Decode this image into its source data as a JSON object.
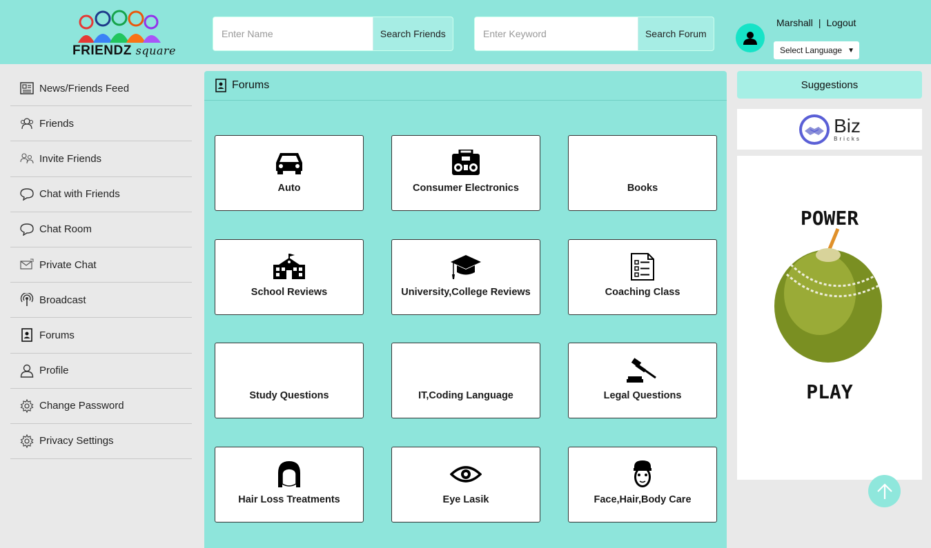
{
  "header": {
    "logo": {
      "brand": "FRIENDZ",
      "suffix": "square"
    },
    "search_friends": {
      "placeholder": "Enter Name",
      "button": "Search Friends"
    },
    "search_forum": {
      "placeholder": "Enter Keyword",
      "button": "Search Forum"
    },
    "user": {
      "name": "Marshall",
      "separator": "|",
      "logout": "Logout"
    },
    "language": {
      "selected": "Select Language"
    }
  },
  "sidebar": {
    "items": [
      {
        "label": "News/Friends Feed",
        "icon": "newspaper-icon"
      },
      {
        "label": "Friends",
        "icon": "friends-icon"
      },
      {
        "label": "Invite Friends",
        "icon": "invite-friends-icon"
      },
      {
        "label": "Chat with Friends",
        "icon": "chat-bubble-icon"
      },
      {
        "label": "Chat Room",
        "icon": "chat-bubble-icon"
      },
      {
        "label": "Private Chat",
        "icon": "envelope-icon"
      },
      {
        "label": "Broadcast",
        "icon": "broadcast-icon"
      },
      {
        "label": "Forums",
        "icon": "forum-document-icon"
      },
      {
        "label": "Profile",
        "icon": "user-icon"
      },
      {
        "label": "Change Password",
        "icon": "gear-icon"
      },
      {
        "label": "Privacy Settings",
        "icon": "gear-icon"
      }
    ]
  },
  "main": {
    "title": "Forums",
    "categories": [
      {
        "label": "Auto",
        "icon": "car-icon"
      },
      {
        "label": "Consumer Electronics",
        "icon": "boombox-icon"
      },
      {
        "label": "Books",
        "icon": ""
      },
      {
        "label": "School Reviews",
        "icon": "school-building-icon"
      },
      {
        "label": "University,College Reviews",
        "icon": "graduation-cap-icon"
      },
      {
        "label": "Coaching Class",
        "icon": "checklist-icon"
      },
      {
        "label": "Study Questions",
        "icon": ""
      },
      {
        "label": "IT,Coding Language",
        "icon": ""
      },
      {
        "label": "Legal Questions",
        "icon": "gavel-icon"
      },
      {
        "label": "Hair Loss Treatments",
        "icon": "hair-icon"
      },
      {
        "label": "Eye Lasik",
        "icon": "eye-icon"
      },
      {
        "label": "Face,Hair,Body Care",
        "icon": "face-mask-icon"
      }
    ]
  },
  "right": {
    "suggestions_title": "Suggestions",
    "sponsor": {
      "name": "Biz",
      "sub": "Bricks"
    },
    "ad": {
      "top": "POWER",
      "bottom": "PLAY"
    }
  },
  "colors": {
    "accent": "#8ee5db",
    "button": "#a6ede4",
    "avatar": "#16e3c7"
  }
}
